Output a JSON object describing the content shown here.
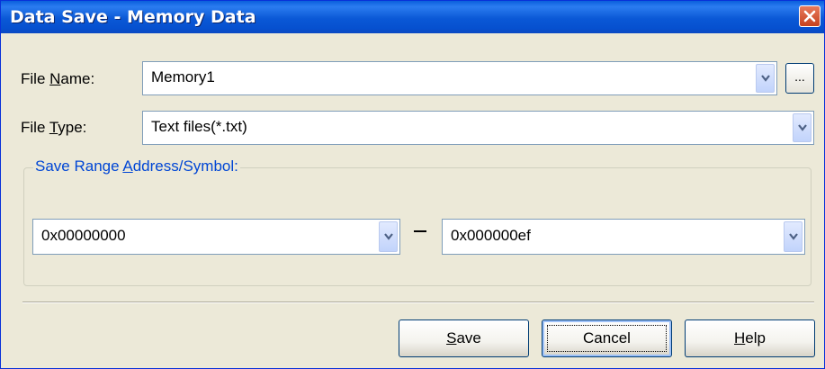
{
  "window": {
    "title": "Data Save - Memory Data"
  },
  "file_name": {
    "label_pre": "File ",
    "label_key": "N",
    "label_post": "ame:",
    "value": "Memory1",
    "browse_label": "..."
  },
  "file_type": {
    "label_pre": "File ",
    "label_key": "T",
    "label_post": "ype:",
    "value": "Text files(*.txt)"
  },
  "range": {
    "title_pre": "Save Range ",
    "title_key": "A",
    "title_post": "ddress/Symbol:",
    "start": "0x00000000",
    "separator": "-",
    "end": "0x000000ef"
  },
  "buttons": {
    "save": {
      "key": "S",
      "rest": "ave"
    },
    "cancel": {
      "label": "Cancel"
    },
    "help": {
      "key": "H",
      "rest": "elp"
    }
  }
}
